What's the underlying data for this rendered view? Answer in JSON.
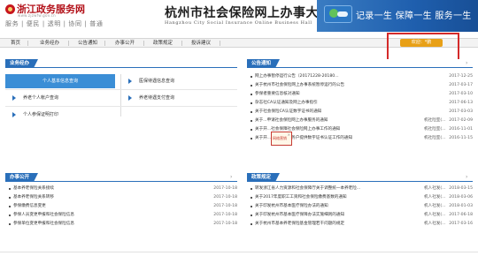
{
  "header": {
    "portal_name": "浙江政务服务网",
    "portal_url": "www.zjzwfw.gov.cn",
    "portal_slogan": "服务 | 便民 | 透明 | 协同 | 普通",
    "site_title": "杭州市社会保险网上办事大厅",
    "site_subtitle": "Hangzhou City Social Insurance Online Business Hall",
    "banner_slogan": "记录一生  保障一生  服务一生"
  },
  "nav": {
    "items": [
      "首页",
      "业务经办",
      "公告通知",
      "办事公开",
      "政策规定",
      "投诉建议"
    ]
  },
  "user": {
    "welcome": "欢迎：*鹏"
  },
  "business": {
    "title": "业务经办",
    "buttons": [
      {
        "label": "个人基本信息查询",
        "active": true
      },
      {
        "label": "医保待遇信息查询",
        "active": false
      },
      {
        "label": "养老个人帐户查询",
        "active": false
      },
      {
        "label": "养老待遇支付查询",
        "active": false
      },
      {
        "label": "个人参保证明打印",
        "active": false
      }
    ]
  },
  "notices": {
    "title": "公告通知",
    "rows": [
      {
        "title": "网上办事暂停运行公告（20171228-20180...",
        "dept": "",
        "date": "2017-12-25"
      },
      {
        "title": "关于杭州市社会保险网上办事系统暂停运行的公告",
        "dept": "",
        "date": "2017-03-17"
      },
      {
        "title": "参保者重要信息核对通知",
        "dept": "",
        "date": "2017-03-10"
      },
      {
        "title": "杂志社CA认证通知及网上办事指引",
        "dept": "",
        "date": "2017-06-13"
      },
      {
        "title": "关于社会保险CA认证数字证书的通知",
        "dept": "",
        "date": "2017-03-03"
      },
      {
        "title": "关于...申请社会保险网上办事服务的通知",
        "dept": "机社险室(...",
        "date": "2017-02-09"
      },
      {
        "title": "关于开...社会保障社会保险网上办事工作的通知",
        "dept": "机社险室(...",
        "date": "2016-11-01"
      },
      {
        "title": "关于开...网上办事服务户提供数字证书认证工作的通知",
        "dept": "机社险室(...",
        "date": "2016-11-15"
      }
    ]
  },
  "ad": {
    "label": "网络营销",
    "close": "×"
  },
  "disclosure": {
    "title": "办事公开",
    "rows": [
      {
        "title": "基本养老保险关系接续",
        "date": "2017-10-18"
      },
      {
        "title": "基本养老保险关系转移",
        "date": "2017-10-18"
      },
      {
        "title": "参保缴费信息变更",
        "date": "2017-10-18"
      },
      {
        "title": "参保人员变更申报和社会保险信息",
        "date": "2017-10-18"
      },
      {
        "title": "参保单位变更申报和社会保险信息",
        "date": "2017-10-18"
      }
    ]
  },
  "policies": {
    "title": "政策规定",
    "rows": [
      {
        "title": "转发浙江省人力资源和社会保障厅关于调整统一本养老险...",
        "dept": "机人社发(...",
        "date": "2018-03-15"
      },
      {
        "title": "关于2017年度职工工资和社会保险缴费基数的通知",
        "dept": "机人社发(...",
        "date": "2018-03-06"
      },
      {
        "title": "关于印发杭州市基本医疗保险办法的通知",
        "dept": "机人社发(...",
        "date": "2018-01-03"
      },
      {
        "title": "关于印发杭州市基本医疗保障办法实施细则的通知",
        "dept": "机人社发(...",
        "date": "2017-06-18"
      },
      {
        "title": "关于杭州市基本养老保险基金管理若干问题的规定",
        "dept": "机人社发(...",
        "date": "2017-03-16"
      }
    ]
  }
}
